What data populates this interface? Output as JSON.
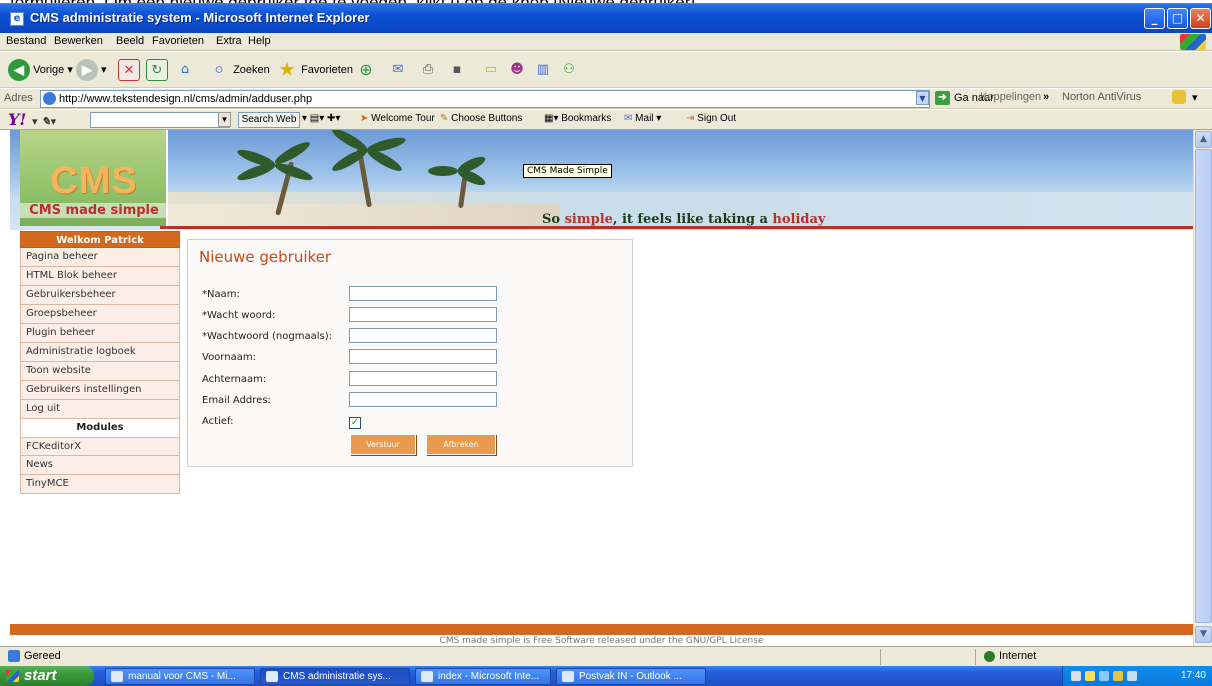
{
  "caption": "formulieren. Om een nieuwe gebruiker toe te voegen, klikt u op de knop [Nieuwe gebruiker].",
  "window": {
    "title": "CMS administratie system - Microsoft Internet Explorer"
  },
  "menu": [
    "Bestand",
    "Bewerken",
    "Beeld",
    "Favorieten",
    "Extra",
    "Help"
  ],
  "toolbar": {
    "back": "Vorige",
    "search": "Zoeken",
    "favorites": "Favorieten"
  },
  "address": {
    "label": "Adres",
    "url": "http://www.tekstendesign.nl/cms/admin/adduser.php",
    "go": "Ga naar",
    "links": "Koppelingen",
    "chevron": "»",
    "norton": "Norton AntiVirus"
  },
  "yahoo": {
    "search_button": "Search Web",
    "items": [
      "Welcome Tour",
      "Choose Buttons",
      "Bookmarks",
      "Mail",
      "Sign Out"
    ]
  },
  "banner": {
    "logo": "CMS",
    "subtitle": "CMS made simple",
    "tooltip": "CMS Made Simple",
    "tagline_1": "So ",
    "tagline_2": "simple",
    "tagline_3": ", it feels like taking a ",
    "tagline_4": "holiday"
  },
  "sidebar": {
    "welcome": "Welkom Patrick",
    "items": [
      "Pagina beheer",
      "HTML Blok beheer",
      "Gebruikersbeheer",
      "Groepsbeheer",
      "Plugin beheer",
      "Administratie logboek",
      "Toon website",
      "Gebruikers instellingen",
      "Log uit"
    ],
    "modules_heading": "Modules",
    "modules": [
      "FCKeditorX",
      "News",
      "TinyMCE"
    ]
  },
  "form": {
    "title": "Nieuwe gebruiker",
    "fields": [
      {
        "label": "*Naam:",
        "value": ""
      },
      {
        "label": "*Wacht woord:",
        "value": ""
      },
      {
        "label": "*Wachtwoord (nogmaals):",
        "value": ""
      },
      {
        "label": "Voornaam:",
        "value": ""
      },
      {
        "label": "Achternaam:",
        "value": ""
      },
      {
        "label": "Email Addres:",
        "value": ""
      }
    ],
    "active_label": "Actief:",
    "active": true,
    "submit": "Verstuur",
    "cancel": "Afbreken"
  },
  "footer": "CMS made simple is Free Software released under the GNU/GPL License",
  "status": {
    "text": "Gereed",
    "zone": "Internet"
  },
  "taskbar": {
    "start": "start",
    "tasks": [
      "manual voor CMS - Mi...",
      "CMS administratie sys...",
      "index - Microsoft Inte...",
      "Postvak IN - Outlook ..."
    ],
    "clock": "17:40"
  },
  "colors": {
    "accent": "#d2691e",
    "title_red": "#c84a1a",
    "xp_blue": "#0a4fd4"
  }
}
